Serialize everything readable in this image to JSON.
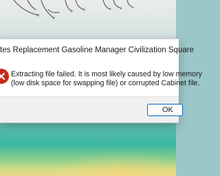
{
  "dialog": {
    "title": "tes Replacement Gasoline Manager Civilization Square",
    "icon": "error-icon",
    "message_line1": "Extracting file failed.  It is most likely caused by low memory",
    "message_line2": "(low disk space for swapping file) or corrupted Cabinet file.",
    "ok_label": "OK"
  },
  "colors": {
    "error_icon": "#c42b1c",
    "accent": "#0067c0"
  }
}
